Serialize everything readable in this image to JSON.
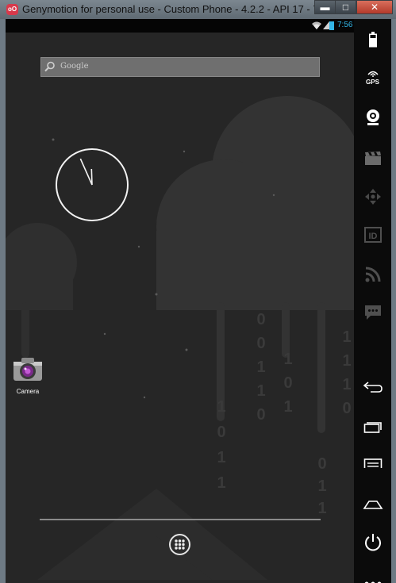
{
  "window": {
    "title": "Genymotion for personal use - Custom Phone - 4.2.2 - API 17 - 76...",
    "logo_text": "oO",
    "minimize": "▬",
    "maximize": "□",
    "close": "✕"
  },
  "statusbar": {
    "time": "7:56",
    "accent_color": "#33b5e5"
  },
  "search": {
    "placeholder": "Google"
  },
  "clock_widget": {
    "hour": 11,
    "minute": 56
  },
  "shortcuts": [
    {
      "label": "Camera",
      "icon": "camera-icon"
    }
  ],
  "dock": {
    "all_apps_icon": "all-apps-icon"
  },
  "wallpaper": {
    "rain_digits": [
      "0",
      "0",
      "1",
      "1",
      "0",
      "1",
      "1",
      "0",
      "1",
      "1",
      "1",
      "1",
      "1",
      "0",
      "0",
      "1",
      "1",
      "0",
      "1"
    ]
  },
  "sidebar": {
    "gps_label": "GPS",
    "icons": [
      "battery-icon",
      "gps-icon",
      "webcam-icon",
      "screencast-icon",
      "move-icon",
      "device-id-icon",
      "rss-icon",
      "sms-icon",
      "back-icon",
      "recent-apps-icon",
      "menu-icon",
      "home-icon",
      "power-icon",
      "more-icon"
    ]
  }
}
